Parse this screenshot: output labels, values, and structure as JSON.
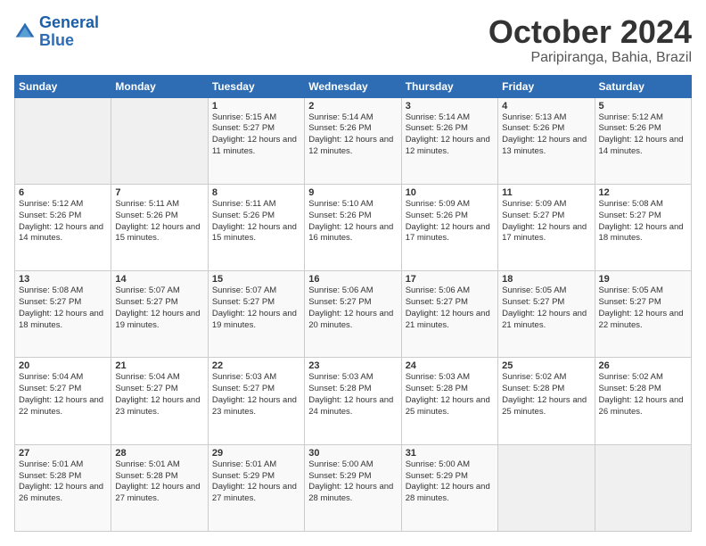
{
  "logo": {
    "line1": "General",
    "line2": "Blue"
  },
  "title": "October 2024",
  "location": "Paripiranga, Bahia, Brazil",
  "weekdays": [
    "Sunday",
    "Monday",
    "Tuesday",
    "Wednesday",
    "Thursday",
    "Friday",
    "Saturday"
  ],
  "weeks": [
    [
      {
        "day": "",
        "detail": ""
      },
      {
        "day": "",
        "detail": ""
      },
      {
        "day": "1",
        "detail": "Sunrise: 5:15 AM\nSunset: 5:27 PM\nDaylight: 12 hours and 11 minutes."
      },
      {
        "day": "2",
        "detail": "Sunrise: 5:14 AM\nSunset: 5:26 PM\nDaylight: 12 hours and 12 minutes."
      },
      {
        "day": "3",
        "detail": "Sunrise: 5:14 AM\nSunset: 5:26 PM\nDaylight: 12 hours and 12 minutes."
      },
      {
        "day": "4",
        "detail": "Sunrise: 5:13 AM\nSunset: 5:26 PM\nDaylight: 12 hours and 13 minutes."
      },
      {
        "day": "5",
        "detail": "Sunrise: 5:12 AM\nSunset: 5:26 PM\nDaylight: 12 hours and 14 minutes."
      }
    ],
    [
      {
        "day": "6",
        "detail": "Sunrise: 5:12 AM\nSunset: 5:26 PM\nDaylight: 12 hours and 14 minutes."
      },
      {
        "day": "7",
        "detail": "Sunrise: 5:11 AM\nSunset: 5:26 PM\nDaylight: 12 hours and 15 minutes."
      },
      {
        "day": "8",
        "detail": "Sunrise: 5:11 AM\nSunset: 5:26 PM\nDaylight: 12 hours and 15 minutes."
      },
      {
        "day": "9",
        "detail": "Sunrise: 5:10 AM\nSunset: 5:26 PM\nDaylight: 12 hours and 16 minutes."
      },
      {
        "day": "10",
        "detail": "Sunrise: 5:09 AM\nSunset: 5:26 PM\nDaylight: 12 hours and 17 minutes."
      },
      {
        "day": "11",
        "detail": "Sunrise: 5:09 AM\nSunset: 5:27 PM\nDaylight: 12 hours and 17 minutes."
      },
      {
        "day": "12",
        "detail": "Sunrise: 5:08 AM\nSunset: 5:27 PM\nDaylight: 12 hours and 18 minutes."
      }
    ],
    [
      {
        "day": "13",
        "detail": "Sunrise: 5:08 AM\nSunset: 5:27 PM\nDaylight: 12 hours and 18 minutes."
      },
      {
        "day": "14",
        "detail": "Sunrise: 5:07 AM\nSunset: 5:27 PM\nDaylight: 12 hours and 19 minutes."
      },
      {
        "day": "15",
        "detail": "Sunrise: 5:07 AM\nSunset: 5:27 PM\nDaylight: 12 hours and 19 minutes."
      },
      {
        "day": "16",
        "detail": "Sunrise: 5:06 AM\nSunset: 5:27 PM\nDaylight: 12 hours and 20 minutes."
      },
      {
        "day": "17",
        "detail": "Sunrise: 5:06 AM\nSunset: 5:27 PM\nDaylight: 12 hours and 21 minutes."
      },
      {
        "day": "18",
        "detail": "Sunrise: 5:05 AM\nSunset: 5:27 PM\nDaylight: 12 hours and 21 minutes."
      },
      {
        "day": "19",
        "detail": "Sunrise: 5:05 AM\nSunset: 5:27 PM\nDaylight: 12 hours and 22 minutes."
      }
    ],
    [
      {
        "day": "20",
        "detail": "Sunrise: 5:04 AM\nSunset: 5:27 PM\nDaylight: 12 hours and 22 minutes."
      },
      {
        "day": "21",
        "detail": "Sunrise: 5:04 AM\nSunset: 5:27 PM\nDaylight: 12 hours and 23 minutes."
      },
      {
        "day": "22",
        "detail": "Sunrise: 5:03 AM\nSunset: 5:27 PM\nDaylight: 12 hours and 23 minutes."
      },
      {
        "day": "23",
        "detail": "Sunrise: 5:03 AM\nSunset: 5:28 PM\nDaylight: 12 hours and 24 minutes."
      },
      {
        "day": "24",
        "detail": "Sunrise: 5:03 AM\nSunset: 5:28 PM\nDaylight: 12 hours and 25 minutes."
      },
      {
        "day": "25",
        "detail": "Sunrise: 5:02 AM\nSunset: 5:28 PM\nDaylight: 12 hours and 25 minutes."
      },
      {
        "day": "26",
        "detail": "Sunrise: 5:02 AM\nSunset: 5:28 PM\nDaylight: 12 hours and 26 minutes."
      }
    ],
    [
      {
        "day": "27",
        "detail": "Sunrise: 5:01 AM\nSunset: 5:28 PM\nDaylight: 12 hours and 26 minutes."
      },
      {
        "day": "28",
        "detail": "Sunrise: 5:01 AM\nSunset: 5:28 PM\nDaylight: 12 hours and 27 minutes."
      },
      {
        "day": "29",
        "detail": "Sunrise: 5:01 AM\nSunset: 5:29 PM\nDaylight: 12 hours and 27 minutes."
      },
      {
        "day": "30",
        "detail": "Sunrise: 5:00 AM\nSunset: 5:29 PM\nDaylight: 12 hours and 28 minutes."
      },
      {
        "day": "31",
        "detail": "Sunrise: 5:00 AM\nSunset: 5:29 PM\nDaylight: 12 hours and 28 minutes."
      },
      {
        "day": "",
        "detail": ""
      },
      {
        "day": "",
        "detail": ""
      }
    ]
  ]
}
